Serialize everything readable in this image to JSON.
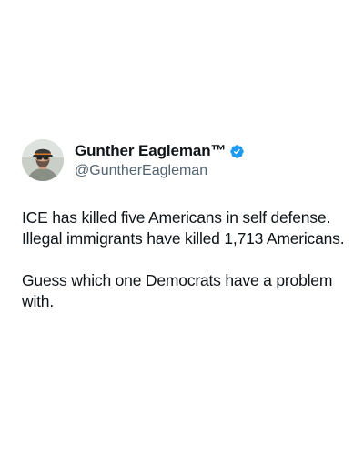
{
  "tweet": {
    "author": {
      "display_name": "Gunther Eagleman™",
      "handle": "@GuntherEagleman",
      "verified": true,
      "avatar_icon": "profile-photo-icon",
      "verified_icon": "verified-badge-icon",
      "verified_color": "#1d9bf0"
    },
    "paragraphs": [
      {
        "lines": [
          "ICE has killed five Americans in self defense.",
          "Illegal immigrants have killed 1,713 Americans."
        ]
      },
      {
        "lines": [
          "Guess which one Democrats have a problem",
          "with."
        ]
      }
    ]
  },
  "colors": {
    "background": "#ffffff",
    "text_primary": "#0f1419",
    "text_secondary": "#536471"
  }
}
